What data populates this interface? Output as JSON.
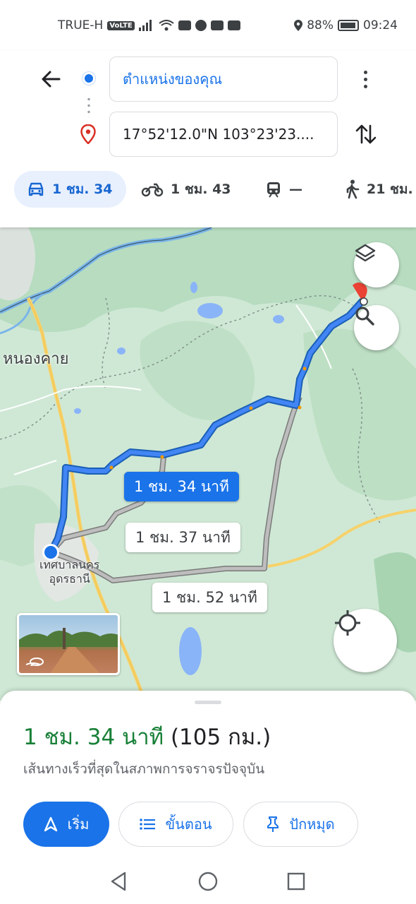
{
  "status_bar": {
    "carrier": "TRUE-H",
    "network_badge": "VoLTE",
    "battery": "88%",
    "time": "09:24"
  },
  "search": {
    "origin": "ตำแหน่งของคุณ",
    "destination": "17°52'12.0\"N 103°23'23...."
  },
  "travel_modes": [
    {
      "mode": "car",
      "icon": "car-icon",
      "time": "1 ชม. 34"
    },
    {
      "mode": "motorcycle",
      "icon": "motorcycle-icon",
      "time": "1 ชม. 43"
    },
    {
      "mode": "transit",
      "icon": "train-icon",
      "time": "—"
    },
    {
      "mode": "walk",
      "icon": "walking-icon",
      "time": "21 ชม."
    }
  ],
  "map": {
    "place_city": "หนองคาย",
    "place_town_line1": "เทศบาลนคร",
    "place_town_line2": "อุดรธานี",
    "routes": [
      {
        "label": "1 ชม. 34 นาที",
        "selected": true
      },
      {
        "label": "1 ชม. 37 นาที",
        "selected": false
      },
      {
        "label": "1 ชม. 52 นาที",
        "selected": false
      }
    ]
  },
  "sheet": {
    "duration": "1 ชม. 34 นาที",
    "distance": "(105 กม.)",
    "description": "เส้นทางเร็วที่สุดในสภาพการจราจรปัจจุบัน",
    "start_label": "เริ่ม",
    "steps_label": "ขั้นตอน",
    "pin_label": "ปักหมุด"
  },
  "colors": {
    "accent": "#1a73e8",
    "route_primary": "#1a73e8",
    "route_alt": "#9e9e9e",
    "duration_green": "#188038",
    "map_land": "#cfe8d5",
    "destination_red": "#ea4335"
  }
}
